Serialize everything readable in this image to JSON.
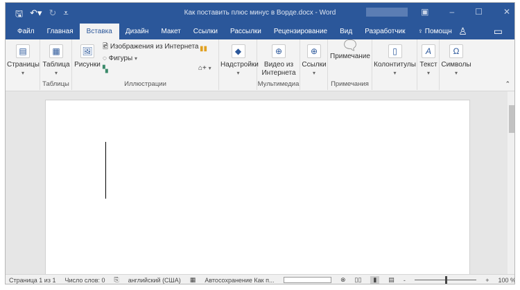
{
  "titlebar": {
    "title": "Как поставить плюс минус в Ворде.docx - Word",
    "save_icon": "save-icon",
    "undo_icon": "undo-icon",
    "redo_icon": "redo-icon"
  },
  "tabs": [
    "Файл",
    "Главная",
    "Вставка",
    "Дизайн",
    "Макет",
    "Ссылки",
    "Рассылки",
    "Рецензирование",
    "Вид",
    "Разработчик",
    "Помощн"
  ],
  "active_tab": "Вставка",
  "ribbon": {
    "pages": "Страницы",
    "table": "Таблица",
    "tables_group": "Таблицы",
    "pictures": "Рисунки",
    "online_images": "Изображения из Интернета",
    "shapes": "Фигуры",
    "illustrations_group": "Иллюстрации",
    "addins": "Надстройки",
    "video": "Видео из Интернета",
    "media_group": "Мультимедиа",
    "links": "Ссылки",
    "comment": "Примечание",
    "comments_group": "Примечания",
    "headers": "Колонтитулы",
    "text": "Текст",
    "symbols": "Символы"
  },
  "status": {
    "page": "Страница 1 из 1",
    "words": "Число слов: 0",
    "language": "английский (США)",
    "autosave": "Автосохранение Как п...",
    "zoom": "100 %",
    "zoom_percent": 100
  },
  "colors": {
    "accent": "#2b579a"
  }
}
